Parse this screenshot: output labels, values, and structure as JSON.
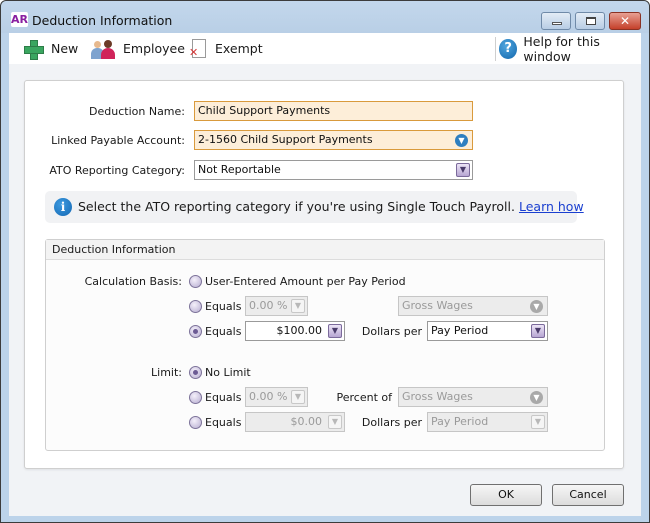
{
  "window": {
    "app_badge": "AR",
    "title": "Deduction Information",
    "controls": {
      "minimize": "minimize",
      "maximize": "maximize",
      "close": "✕"
    }
  },
  "toolbar": {
    "new_label": "New",
    "employee_label": "Employee",
    "exempt_label": "Exempt",
    "help_label": "Help for this window",
    "help_glyph": "?"
  },
  "form": {
    "deduction_name": {
      "label": "Deduction Name:",
      "value": "Child Support Payments"
    },
    "linked_account": {
      "label": "Linked Payable Account:",
      "value": "2-1560 Child Support Payments"
    },
    "ato_category": {
      "label": "ATO Reporting Category:",
      "value": "Not Reportable"
    }
  },
  "info": {
    "glyph": "i",
    "text": "Select the ATO reporting category if you're using Single Touch Payroll.",
    "link": "Learn how"
  },
  "group": {
    "title": "Deduction Information",
    "calculation_basis": {
      "label": "Calculation Basis:",
      "options": [
        {
          "label": "User-Entered Amount per Pay Period",
          "checked": false
        },
        {
          "label": "Equals",
          "checked": false,
          "value": "0.00 %",
          "of_label": "",
          "of_value": "Gross Wages",
          "enabled": false
        },
        {
          "label": "Equals",
          "checked": true,
          "value": "$100.00",
          "of_label": "Dollars per",
          "of_value": "Pay Period",
          "enabled": true
        }
      ]
    },
    "limit": {
      "label": "Limit:",
      "options": [
        {
          "label": "No Limit",
          "checked": true
        },
        {
          "label": "Equals",
          "checked": false,
          "value": "0.00 %",
          "of_label": "Percent of",
          "of_value": "Gross Wages",
          "enabled": false
        },
        {
          "label": "Equals",
          "checked": false,
          "value": "$0.00",
          "of_label": "Dollars per",
          "of_value": "Pay Period",
          "enabled": false
        }
      ]
    }
  },
  "buttons": {
    "ok": "OK",
    "cancel": "Cancel"
  },
  "glyphs": {
    "dropdown": "▼",
    "circle_dropdown": "▼"
  }
}
